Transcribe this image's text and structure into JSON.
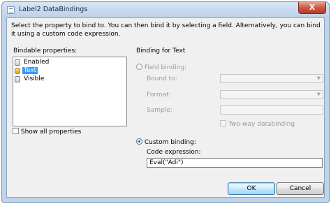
{
  "dialog": {
    "title": "Label2 DataBindings",
    "close_glyph": "X",
    "instruction": "Select the property to bind to. You can then bind it by selecting a field. Alternatively, you can bind it using a custom code expression."
  },
  "bindable": {
    "label": "Bindable properties:",
    "items": [
      {
        "label": "Enabled",
        "icon": "property-icon",
        "selected": false
      },
      {
        "label": "Text",
        "icon": "database-icon",
        "selected": true
      },
      {
        "label": "Visible",
        "icon": "property-icon",
        "selected": false
      }
    ],
    "show_all_label": "Show all properties",
    "show_all_checked": false
  },
  "binding": {
    "label": "Binding for Text",
    "field_binding_label": "Field binding:",
    "field_binding_selected": false,
    "bound_to_label": "Bound to:",
    "format_label": "Format:",
    "sample_label": "Sample:",
    "two_way_label": "Two-way databinding",
    "custom_binding_label": "Custom binding:",
    "custom_binding_selected": true,
    "code_expression_label": "Code expression:",
    "code_expression_value": "Eval(\"Adi\")"
  },
  "buttons": {
    "ok": "OK",
    "cancel": "Cancel"
  },
  "colors": {
    "selection": "#3399ff",
    "close_button": "#c75a44"
  }
}
